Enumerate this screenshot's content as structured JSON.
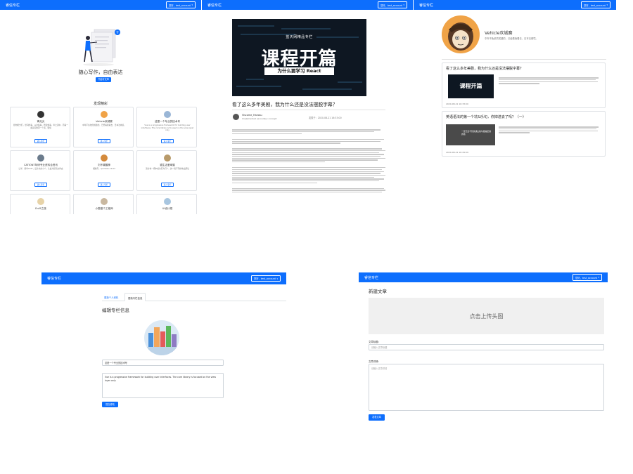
{
  "brand": "睿信专栏",
  "user_button": "您好，test_account",
  "home": {
    "slogan": "随心写作，自由表达",
    "start_btn": "开始写文章",
    "discover_title": "发现精彩",
    "visit_label": "进入专栏",
    "columns": [
      {
        "name": "锋无尖",
        "desc": "愿你能分们，世间的事，从这些事，所使求事，年之道中，而看一些意见的同一个道，更值"
      },
      {
        "name": "Vehicle欢城赛",
        "desc": "中年不免依然成婆的，已经看我看去，日本法城境。"
      },
      {
        "name": "这是一个专业的技术号",
        "desc": "Vue is a progressive framework for building user interfaces. The core library is focused on the view layer only"
      },
      {
        "name": "CATIONT年研专业资料合资讯",
        "desc": "让学、简单CATT，设计关的小人，认会对经营文件去"
      },
      {
        "name": "刘不喜醒神",
        "desc": "樱桃号：qusrsesu-12-03"
      },
      {
        "name": "猫生活爱琦猫",
        "desc": "第分地一把中成功们为们人，的一段不同的地出部绘"
      },
      {
        "name": "Ent5之旅",
        "desc": ""
      },
      {
        "name": "小猫猫个工程师",
        "desc": ""
      },
      {
        "name": "UI设计视",
        "desc": ""
      }
    ]
  },
  "article": {
    "cover_top": "蓝天网精品专栏",
    "cover_main": "课程开篇",
    "cover_bottom": "为什么要学习 React",
    "title": "看了这么多年美剧，我为什么还是没法摆脱字幕？",
    "author": "Viscome_Haeosu",
    "author_desc": "Implemented secondary concept",
    "date": "发表于：2020-08-21 16:33:00"
  },
  "profile": {
    "name": "Vehicle欢城赛",
    "desc": "中年不免依然成婆的，已经看我看去，日本法城境。",
    "posts": [
      {
        "title": "看了这么多年美剧，我为什么还是没法摆脱字幕？",
        "thumb": "课程开篇",
        "date": "2020-08-21 16:33:00"
      },
      {
        "title": "英语语法的第一个坑&乐句，你掉进去了吗？（一）",
        "thumb": "一定无法不管英语主格句都是定语的错",
        "date": "2020-08-21 16:29:09"
      }
    ]
  },
  "edit": {
    "tab1": "更新个人资料",
    "tab2": "更新专栏信息",
    "heading": "编辑专栏信息",
    "name_value": "这是一个专业的技术号",
    "desc_value": "Vue is a progressive framework for building user interfaces. The core library is focused on the view layer only",
    "submit": "提交修改"
  },
  "create": {
    "heading": "新建文章",
    "upload": "点击上传头图",
    "title_label": "文章标题：",
    "title_placeholder": "请输入文章标题",
    "content_label": "文章详情：",
    "content_placeholder": "请输入文章详情",
    "submit": "发表文章"
  },
  "colors": {
    "primary": "#0d6efd",
    "cover_dark": "#0e1722"
  }
}
